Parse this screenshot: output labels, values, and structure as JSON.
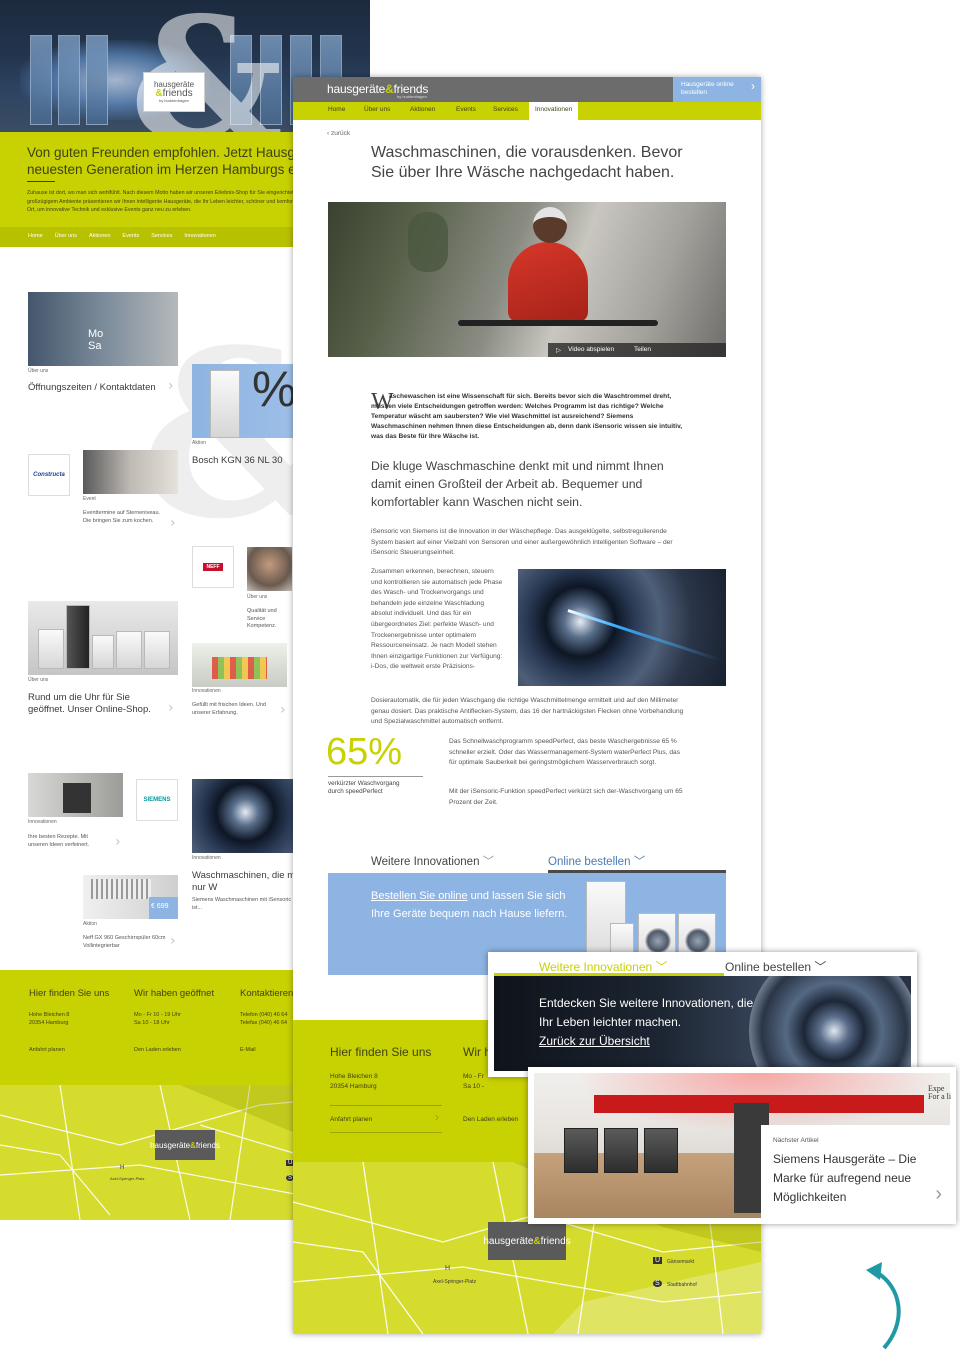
{
  "back_page": {
    "hero_logo": {
      "line1": "hausgeräte",
      "amp": "&",
      "line2": "friends",
      "by": "by buddenhagen"
    },
    "headline": "Von guten Freunden empfohlen. Jetzt Hausgeräte der neuesten Generation im Herzen Hamburgs erleben.",
    "intro": "Zuhause ist dort, wo man sich wohlfühlt. Nach diesem Motto haben wir unseren Erlebnis-Shop für Sie eingerichtet. Mit modernem Design und großzügigem Ambiente präsentieren wir Ihnen intelligente Hausgeräte, die Ihr Leben leichter, schöner und komfortabler machen. Der perfekte Ort, um innovative Technik und exklusive Events ganz neu zu erleben.",
    "nav": [
      "Home",
      "Über uns",
      "Aktionen",
      "Events",
      "Services",
      "Innovationen"
    ],
    "tiles": {
      "t1": {
        "label": "Über uns",
        "title": "Öffnungszeiten / Kontaktdaten",
        "sign": "Mo\nSa"
      },
      "t2": {
        "label": "Aktion",
        "title": "Bosch KGN 36 NL 30",
        "big": "%",
        "price": "€ 5"
      },
      "t3": {
        "brand": "Constructa"
      },
      "t4": {
        "label": "Event",
        "text": "Eventtermine auf Sterneniveau. Die bringen Sie zum kochen."
      },
      "t5": {
        "brand": "NEFF"
      },
      "t6": {
        "label": "Über uns",
        "text": "Qualität und Service Kompetenz."
      },
      "t7": {
        "label": "Über uns",
        "title": "Rund um die Uhr für Sie geöffnet. Unser Online-Shop."
      },
      "t8": {
        "label": "Innovationen",
        "text": "Gefüllt mit frischen Ideen. Und unserer Erfahrung."
      },
      "t9": {
        "label": "Innovationen",
        "text": "Ihre besten Rezepte. Mit unseren Ideen verfeinert."
      },
      "t10": {
        "brand": "SIEMENS"
      },
      "t11": {
        "label": "Innovationen",
        "title": "Waschmaschinen, die mitdenken. Nicht nur W",
        "text": "Siemens Waschmaschinen mit iSensoric ... das Beste für Ihre Wäsche ist..."
      },
      "t12": {
        "label": "Aktion",
        "price": "€ 699",
        "text": "Neff GX 960 Geschirrspüler 60cm Vollintegrierbar"
      }
    },
    "footer": {
      "col1": {
        "title": "Hier finden Sie uns",
        "lines": "Hohe Bleichen 8\n20354 Hamburg",
        "link": "Anfahrt planen"
      },
      "col2": {
        "title": "Wir haben geöffnet",
        "lines": "Mo - Fr 10 - 19 Uhr\nSa 10 - 18 Uhr",
        "link": "Den Laden erleben"
      },
      "col3": {
        "title": "Kontaktieren",
        "lines": "Telefon (040) 46 64\nTelefax (040) 46 64",
        "link": "E-Mail"
      }
    },
    "map": {
      "place": "Axel-Springer-Platz",
      "u": "U",
      "s": "S",
      "h": "H"
    }
  },
  "front_page": {
    "logo": {
      "text": "hausgeräte",
      "amp": "&",
      "text2": "friends",
      "by": "by buddenhagen"
    },
    "order_button": {
      "line1": "Hausgeräte online",
      "line2": "bestellen",
      "arrow": "›"
    },
    "nav": [
      "Home",
      "Über uns",
      "Aktionen",
      "Events",
      "Services",
      "Innovationen"
    ],
    "back_link": "‹  zurück",
    "headline": "Waschmaschinen, die vorausdenken. Bevor Sie über Ihre Wäsche nachgedacht haben.",
    "video_bar": {
      "play": "Video abspielen",
      "share": "Teilen"
    },
    "dropcap": "W",
    "intro": "äschewaschen ist eine Wissenschaft für sich. Bereits bevor sich die Waschtrommel dreht, müssen viele Entscheidungen getroffen werden: Welches Programm ist das richtige? Welche Temperatur wäscht am saubersten? Wie viel Waschmittel ist ausreichend? Siemens Waschmaschinen nehmen Ihnen diese Entscheidungen ab, denn dank iSensoric wissen sie intuitiv, was das Beste für Ihre Wäsche ist.",
    "lead": "Die kluge Waschmaschine denkt mit und nimmt Ihnen damit einen Großteil der Arbeit ab. Bequemer und komfortabler kann Waschen nicht sein.",
    "p1": "iSensoric von Siemens ist die Innovation in der Wäschepflege. Das ausgeklügelte, selbstregulierende System basiert auf einer Vielzahl von Sensoren und einer außergewöhnlich intelligenten Software – der iSensoric Steuerungseinheit.",
    "p2": "Zusammen erkennen, berechnen, steuern und kontrollieren sie automatisch jede Phase des Wasch- und Trockenvorgangs und behandeln jede einzelne Waschladung absolut individuell. Und das für ein übergeordnetes Ziel: perfekte Wasch- und Trockenergebnisse unter optimalem Ressourceneinsatz. Je nach Modell stehen Ihnen einzigartige Funktionen zur Verfügung: i-Dos, die weltweit erste Präzisions-",
    "p3": "Dosierautomatik, die für jeden Waschgang die richtige Waschmittelmenge ermittelt und auf den Millimeter genau dosiert. Das praktische Antiflecken-System, das 16 der hartnäckigsten Flecken ohne Vorbehandlung und Spezialwaschmittel automatisch entfernt.",
    "stat": {
      "value": "65%",
      "caption": "verkürzter Waschvorgang\ndurch speedPerfect"
    },
    "p4": "Das Schnellwaschprogramm speedPerfect, das beste Waschergebnisse 65 % schneller erzielt. Oder das Wassermanagement-System waterPerfect Plus, das für optimale Sauberkeit bei geringstmöglichem Wasserverbrauch sorgt.",
    "p5": "Mit der iSensoric-Funktion speedPerfect verkürzt sich der-Waschvorgang um 65 Prozent der Zeit.",
    "tabs": {
      "more": "Weitere Innovationen",
      "order": "Online bestellen"
    },
    "banner": {
      "link": "Bestellen Sie online",
      "rest": " und lassen Sie sich Ihre Geräte bequem nach Hause liefern."
    },
    "footer": {
      "col1": {
        "title": "Hier finden Sie uns",
        "lines": "Hohe Bleichen 8\n20354 Hamburg",
        "link": "Anfahrt planen"
      },
      "col2": {
        "title": "Wir h",
        "lines": "Mo - Fr\nSa 10 -",
        "link": "Den Laden erleben"
      }
    },
    "map": {
      "place": "Axel-Springer-Platz",
      "u_label": "Gänsemarkt",
      "s_label": "Stadtbahnhof",
      "u": "U",
      "s": "S",
      "h": "H"
    }
  },
  "popup_more": {
    "tab_more": "Weitere Innovationen",
    "tab_order": "Online bestellen",
    "text": "Entdecken Sie weitere Innovationen, die Ihr Leben leichter machen.",
    "link": "Zurück zur Übersicht"
  },
  "popup_next": {
    "label": "Nächster Artikel",
    "title": "Siemens Hausgeräte – Die Marke für aufregend neue Möglichkeiten",
    "sign": "Expe\nFor a li",
    "arrow": "›"
  },
  "colors": {
    "lime": "#c8d102",
    "blue": "#8db4e2",
    "grey_bar": "#6c6c6c",
    "link_blue": "#4b7bb5"
  }
}
